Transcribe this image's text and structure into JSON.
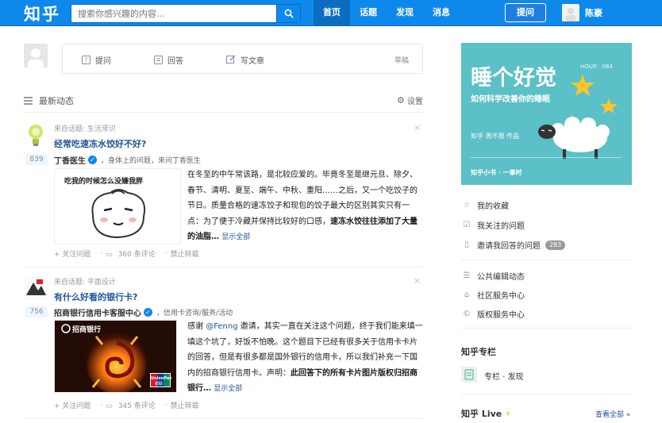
{
  "topbar": {
    "logo": "知乎",
    "search_placeholder": "搜索你感兴趣的内容...",
    "nav": [
      "首页",
      "话题",
      "发现",
      "消息"
    ],
    "ask_label": "提问",
    "user_name": "陈豪"
  },
  "composer": {
    "ask": "提问",
    "answer": "回答",
    "write": "写文章",
    "drafts": "草稿"
  },
  "feed": {
    "title": "最新动态",
    "settings": "设置",
    "items": [
      {
        "source": "来自话题: 生活常识",
        "question": "经常吃速冻水饺好不好?",
        "votes": "839",
        "author": "丁香医生",
        "author_bio": "，身体上的问题，来问丁香医生",
        "thumb_caption": "吃我的时候怎么没嫌我胖",
        "excerpt": "在冬至的中午常该路，是北较应爱的。毕竟冬至是继元旦、除夕、春节、清明、夏至、端午、中秋、重阳……之后，又一个吃饺子的节日。质量合格的速冻饺子和现包的饺子最大的区别其实只有一点：为了便于冷藏并保持比较好的口感，",
        "excerpt_bold": "速冻水饺往往添加了大量的油脂…",
        "more": "显示全部",
        "follow": "关注问题",
        "comments": "360 条评论",
        "no_repost": "禁止转载"
      },
      {
        "source": "来自话题: 平面设计",
        "question": "有什么好看的银行卡?",
        "votes": "756",
        "author": "招商银行信用卡客服中心",
        "author_bio": "，信用卡咨询/服务/活动",
        "bank_name": "招商银行",
        "card_brand": "UnionPay",
        "card_brand_cn": "银联",
        "excerpt_pre": "感谢",
        "mention": "@Fenng",
        "excerpt": "邀请，其实一直在关注这个问题，终于我们能来填一填这个坑了，好饭不怕晚。这个题目下已经有很多关于信用卡卡片的回答，但是有很多都是国外银行的信用卡，所以我们补充一下国内的招商银行信用卡。声明：",
        "excerpt_bold": "此回答下的所有卡片图片版权归招商银行…",
        "more": "显示全部",
        "follow": "关注问题",
        "comments": "345 条评论",
        "no_repost": "禁止转载"
      }
    ]
  },
  "promo": {
    "title": "睡个好觉",
    "subtitle": "如何科学改善你的睡眠",
    "hour": "HOUR：064",
    "author": "知乎  周不周 作品",
    "brand": "知乎小书 · 一事时"
  },
  "sidebar": {
    "links1": [
      {
        "label": "我的收藏",
        "icon": "star-icon"
      },
      {
        "label": "我关注的问题",
        "icon": "check-square-icon"
      },
      {
        "label": "邀请我回答的问题",
        "icon": "doc-icon",
        "badge": "283"
      }
    ],
    "links2": [
      {
        "label": "公共编辑动态",
        "icon": "list-icon"
      },
      {
        "label": "社区服务中心",
        "icon": "home-icon"
      },
      {
        "label": "版权服务中心",
        "icon": "copyright-icon"
      }
    ],
    "column_head": "知乎专栏",
    "column_text": "专栏 · 发现",
    "live_head": "知乎 Live",
    "live_all": "查看全部 »"
  }
}
